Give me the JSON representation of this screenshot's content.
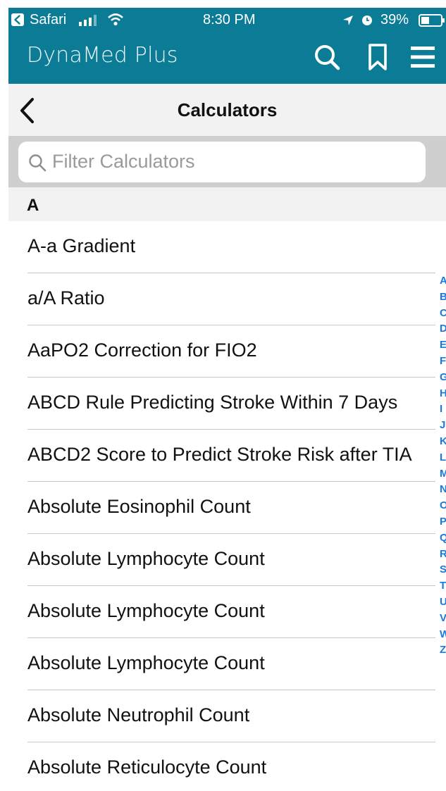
{
  "status": {
    "carrier": "Safari",
    "time": "8:30 PM",
    "battery": "39%"
  },
  "header": {
    "brand": "DynaMed Plus",
    "icons": [
      "search-icon",
      "bookmark-icon",
      "menu-icon"
    ]
  },
  "navbar": {
    "title": "Calculators"
  },
  "search": {
    "placeholder": "Filter Calculators"
  },
  "section": {
    "letter": "A"
  },
  "items": [
    "A-a Gradient",
    "a/A Ratio",
    "AaPO2 Correction for FIO2",
    "ABCD Rule Predicting Stroke Within 7 Days",
    "ABCD2 Score to Predict Stroke Risk after TIA",
    "Absolute Eosinophil Count",
    "Absolute Lymphocyte Count",
    "Absolute Lymphocyte Count",
    "Absolute Lymphocyte Count",
    "Absolute Neutrophil Count",
    "Absolute Reticulocyte Count"
  ],
  "index_letters": [
    "A",
    "B",
    "C",
    "D",
    "E",
    "F",
    "G",
    "H",
    "I",
    "J",
    "K",
    "L",
    "M",
    "N",
    "O",
    "P",
    "Q",
    "R",
    "S",
    "T",
    "U",
    "V",
    "W",
    "Z"
  ],
  "colors": {
    "header_bg": "#0b7b96",
    "index": "#1a7ae0"
  }
}
